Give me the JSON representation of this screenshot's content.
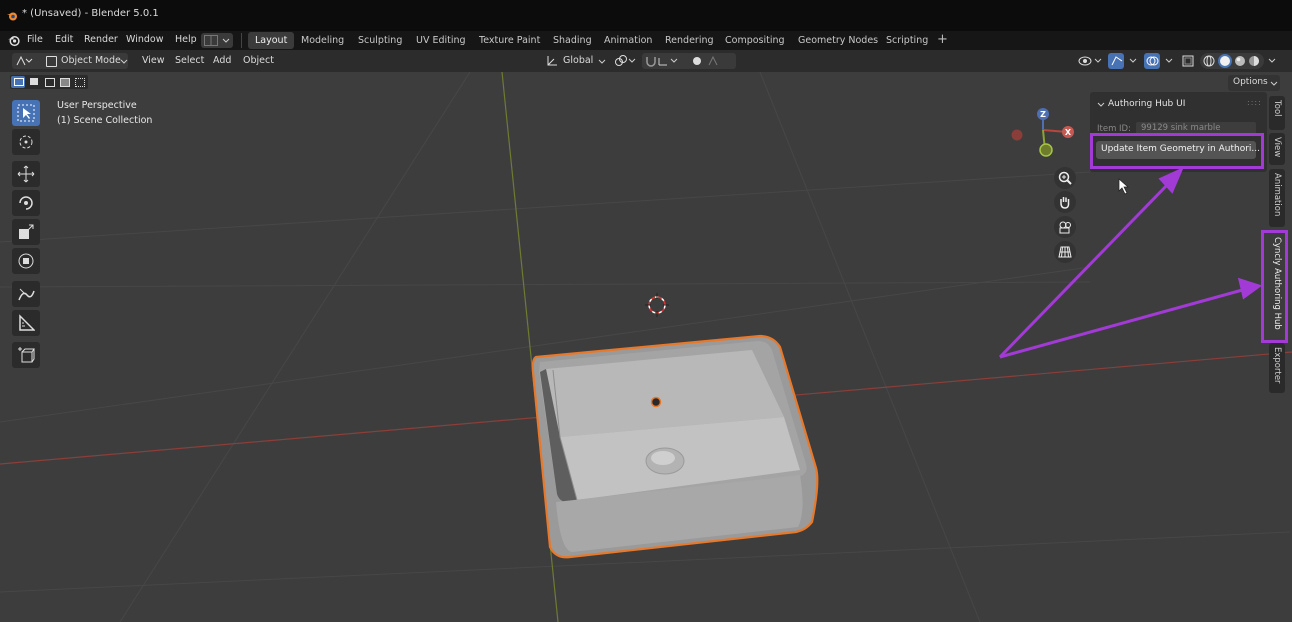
{
  "window": {
    "title": "* (Unsaved) - Blender 5.0.1"
  },
  "menu": {
    "items": [
      "File",
      "Edit",
      "Render",
      "Window",
      "Help"
    ]
  },
  "workspaces": {
    "active": "Layout",
    "tabs": [
      "Layout",
      "Modeling",
      "Sculpting",
      "UV Editing",
      "Texture Paint",
      "Shading",
      "Animation",
      "Rendering",
      "Compositing",
      "Geometry Nodes",
      "Scripting"
    ],
    "add": "+"
  },
  "viewport_header": {
    "mode": "Object Mode",
    "menus": [
      "View",
      "Select",
      "Add",
      "Object"
    ],
    "transform_orientation": "Global",
    "options": "Options"
  },
  "viewport": {
    "view_name": "User Perspective",
    "collection": "(1) Scene Collection"
  },
  "gizmo": {
    "z": "Z",
    "x": "X"
  },
  "npanel": {
    "section_title": "Authoring Hub UI",
    "item_id_label": "Item ID:",
    "item_id_value": "99129 sink marble",
    "update_button": "Update Item Geometry in Authori..."
  },
  "sidebar_tabs": [
    "Tool",
    "View",
    "Animation",
    "Cyncly Authoring Hub",
    "Exporter"
  ],
  "colors": {
    "highlight": "#a23ad6",
    "selection_outline": "#e8782a",
    "x_axis": "#b5473f",
    "y_axis": "#8ca336",
    "active_tool": "#4772b3"
  }
}
